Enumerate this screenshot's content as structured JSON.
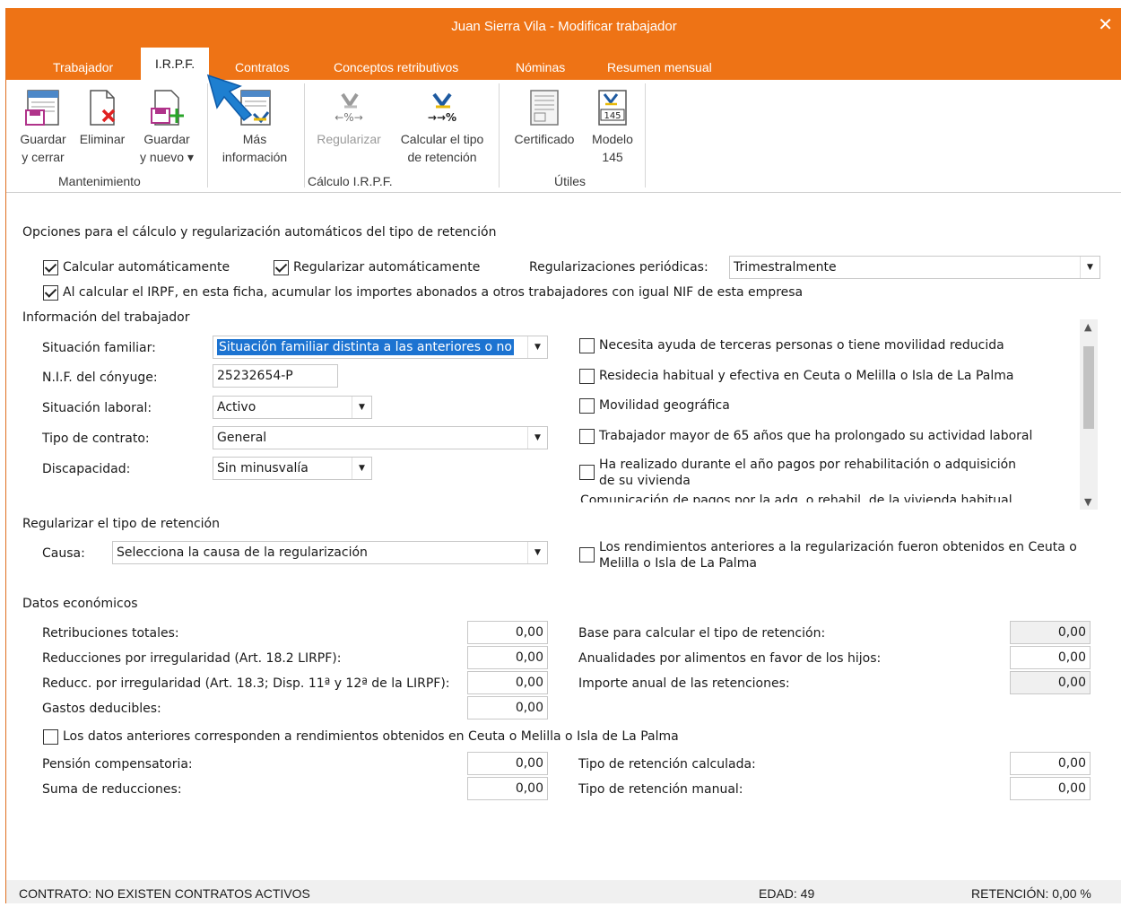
{
  "window": {
    "title": "Juan  Sierra  Vila - Modificar trabajador",
    "close": "✕"
  },
  "tabs": [
    {
      "label": "Trabajador"
    },
    {
      "label": "I.R.P.F."
    },
    {
      "label": "Contratos"
    },
    {
      "label": "Conceptos retributivos"
    },
    {
      "label": "Nóminas"
    },
    {
      "label": "Resumen mensual"
    }
  ],
  "ribbon": {
    "guardar_cerrar": {
      "line1": "Guardar",
      "line2": "y cerrar"
    },
    "eliminar": {
      "line1": "Eliminar"
    },
    "guardar_nuevo": {
      "line1": "Guardar",
      "line2": "y nuevo ▾"
    },
    "mas_info": {
      "line1": "Más",
      "line2": "información"
    },
    "regularizar": {
      "line1": "Regularizar"
    },
    "calcular_tipo": {
      "line1": "Calcular el tipo",
      "line2": "de retención"
    },
    "certificado": {
      "line1": "Certificado"
    },
    "modelo145": {
      "line1": "Modelo",
      "line2": "145",
      "icon_text": "145"
    },
    "groups": {
      "mantenimiento": "Mantenimiento",
      "calculo": "Cálculo I.R.P.F.",
      "utiles": "Útiles"
    }
  },
  "options": {
    "title": "Opciones para el cálculo y regularización automáticos del tipo de retención",
    "calcular_auto": "Calcular automáticamente",
    "regularizar_auto": "Regularizar automáticamente",
    "reg_periodicas_label": "Regularizaciones periódicas:",
    "reg_periodicas_value": "Trimestralmente",
    "acumular": "Al calcular el IRPF, en esta ficha, acumular los importes abonados a otros trabajadores con igual NIF de esta empresa"
  },
  "info": {
    "title": "Información del trabajador",
    "situacion_familiar_label": "Situación familiar:",
    "situacion_familiar_value": "Situación familiar distinta a las anteriores o no",
    "nif_conyuge_label": "N.I.F. del cónyuge:",
    "nif_conyuge_value": "25232654-P",
    "situacion_laboral_label": "Situación laboral:",
    "situacion_laboral_value": "Activo",
    "tipo_contrato_label": "Tipo de contrato:",
    "tipo_contrato_value": "General",
    "discapacidad_label": "Discapacidad:",
    "discapacidad_value": "Sin minusvalía",
    "checks": [
      "Necesita ayuda de terceras personas o tiene movilidad reducida",
      "Residecia habitual y efectiva en Ceuta o Melilla o Isla de La Palma",
      "Movilidad geográfica",
      "Trabajador mayor de 65 años que ha prolongado su actividad laboral",
      "Ha realizado durante el año pagos por rehabilitación o adquisición",
      "de su vivienda"
    ],
    "cut_text": "Comunicación de pagos por la adq. o rehabil. de la vivienda habitual"
  },
  "regularizar": {
    "title": "Regularizar el tipo de retención",
    "causa_label": "Causa:",
    "causa_value": "Selecciona la causa de la regularización",
    "ceuta_line1": "Los rendimientos anteriores a la regularización fueron obtenidos en Ceuta o",
    "ceuta_line2": "Melilla o Isla de La Palma"
  },
  "economicos": {
    "title": "Datos económicos",
    "left": [
      {
        "label": "Retribuciones totales:",
        "value": "0,00"
      },
      {
        "label": "Reducciones por irregularidad (Art. 18.2 LIRPF):",
        "value": "0,00"
      },
      {
        "label": "Reducc. por irregularidad (Art. 18.3; Disp. 11ª y 12ª de la LIRPF):",
        "value": "0,00"
      },
      {
        "label": "Gastos deducibles:",
        "value": "0,00"
      }
    ],
    "right": [
      {
        "label": "Base para calcular el tipo de retención:",
        "value": "0,00"
      },
      {
        "label": "Anualidades por alimentos en favor de los hijos:",
        "value": "0,00"
      },
      {
        "label": "Importe anual de las retenciones:",
        "value": "0,00"
      }
    ],
    "ceuta": "Los datos anteriores corresponden a rendimientos obtenidos en Ceuta o Melilla o Isla de La Palma",
    "pension_label": "Pensión compensatoria:",
    "pension_value": "0,00",
    "suma_label": "Suma de reducciones:",
    "suma_value": "0,00",
    "tipo_calc_label": "Tipo de retención calculada:",
    "tipo_calc_value": "0,00",
    "tipo_manual_label": "Tipo de retención manual:",
    "tipo_manual_value": "0,00"
  },
  "status": {
    "contrato": "CONTRATO: NO EXISTEN CONTRATOS ACTIVOS",
    "edad": "EDAD: 49",
    "retencion": "RETENCIÓN: 0,00 %"
  },
  "colors": {
    "accent": "#ee7315",
    "selection": "#1c73d1",
    "cursor": "#1e7fd0"
  }
}
